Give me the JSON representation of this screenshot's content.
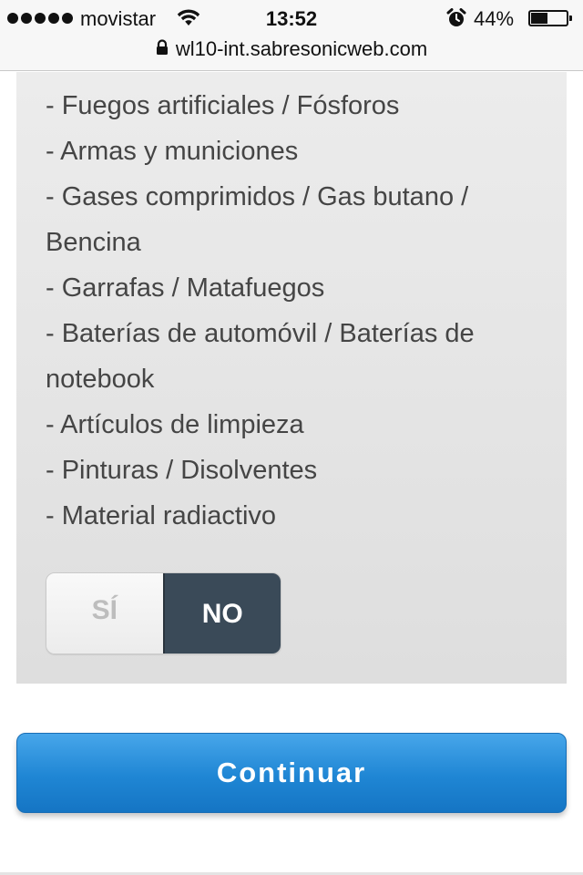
{
  "status_bar": {
    "carrier": "movistar",
    "time": "13:52",
    "battery_percent_label": "44%",
    "battery_level": 0.44,
    "signal_dots": 5
  },
  "address_bar": {
    "url": "wl10-int.sabresonicweb.com"
  },
  "prohibited_items": [
    "- Fuegos artificiales / Fósforos",
    "- Armas y municiones",
    "- Gases comprimidos / Gas butano / Bencina",
    "- Garrafas / Matafuegos",
    "- Baterías de automóvil / Baterías de notebook",
    "- Artículos de limpieza",
    "- Pinturas / Disolventes",
    "- Material radiactivo"
  ],
  "toggle": {
    "yes_label": "SÍ",
    "no_label": "NO",
    "selected": "NO"
  },
  "continue_button": {
    "label": "Continuar"
  },
  "colors": {
    "panel_bg": "#e4e4e4",
    "toggle_selected_bg": "#3a4a58",
    "toggle_unselected_text": "#bdbdbd",
    "primary_button": "#1f86d4",
    "text": "#454545"
  },
  "icons": {
    "wifi": "wifi-icon",
    "alarm": "alarm-clock-icon",
    "lock": "lock-icon",
    "battery": "battery-icon"
  }
}
